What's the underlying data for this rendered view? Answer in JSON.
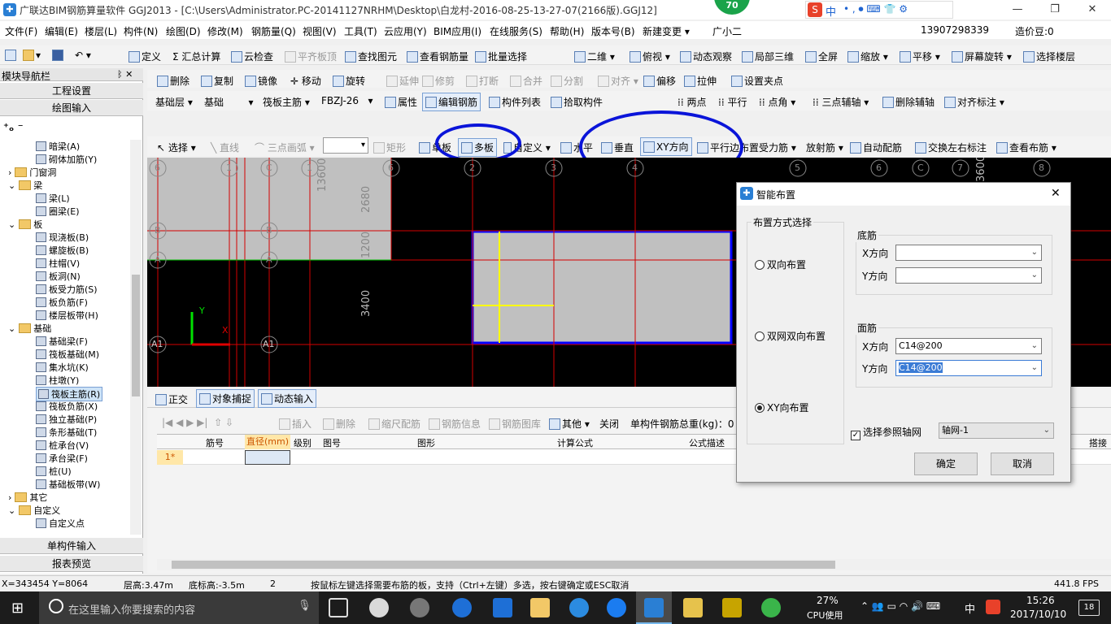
{
  "window": {
    "title": "广联达BIM钢筋算量软件 GGJ2013 - [C:\\Users\\Administrator.PC-20141127NRHM\\Desktop\\白龙村-2016-08-25-13-27-07(2166版).GGJ12]",
    "badge": "70",
    "ime": "中",
    "minimize": "—",
    "restore": "❐",
    "close": "✕"
  },
  "menubar": {
    "items": [
      "文件(F)",
      "编辑(E)",
      "楼层(L)",
      "构件(N)",
      "绘图(D)",
      "修改(M)",
      "钢筋量(Q)",
      "视图(V)",
      "工具(T)",
      "云应用(Y)",
      "BIM应用(I)",
      "在线服务(S)",
      "帮助(H)",
      "版本号(B)",
      "新建变更 ▾",
      "广小二"
    ],
    "phone": "13907298339",
    "price": "造价豆:0"
  },
  "toolbar1": {
    "items": [
      "定义",
      "汇总计算",
      "云检查",
      "平齐板顶",
      "查找图元",
      "查看钢筋量",
      "批量选择",
      "二维",
      "俯视",
      "动态观察",
      "局部三维",
      "全屏",
      "缩放",
      "平移",
      "屏幕旋转",
      "选择楼层"
    ]
  },
  "toolbar2": {
    "items": [
      "删除",
      "复制",
      "镜像",
      "移动",
      "旋转",
      "延伸",
      "修剪",
      "打断",
      "合并",
      "分割",
      "对齐",
      "偏移",
      "拉伸",
      "设置夹点"
    ]
  },
  "toolbar3": {
    "floor": "基础层",
    "category": "基础",
    "type": "筏板主筋",
    "name": "FBZJ-26",
    "items": [
      "属性",
      "编辑钢筋",
      "构件列表",
      "拾取构件",
      "两点",
      "平行",
      "点角",
      "三点辅轴",
      "删除辅轴",
      "对齐标注"
    ]
  },
  "toolbar4": {
    "items": [
      "选择",
      "直线",
      "三点画弧",
      "矩形",
      "单板",
      "多板",
      "自定义",
      "水平",
      "垂直",
      "XY方向",
      "平行边布置受力筋",
      "放射筋",
      "自动配筋",
      "交换左右标注",
      "查看布筋"
    ]
  },
  "leftnav": {
    "title": "模块导航栏",
    "pin": "ᛒ ✕",
    "tab1": "工程设置",
    "tab2": "绘图输入",
    "tree": [
      {
        "label": "暗梁(A)",
        "level": 2
      },
      {
        "label": "砌体加筋(Y)",
        "level": 2
      },
      {
        "label": "门窗洞",
        "level": 1,
        "folder": true,
        "exp": "›"
      },
      {
        "label": "梁",
        "level": 1,
        "folder": true,
        "exp": "⌄"
      },
      {
        "label": "梁(L)",
        "level": 2
      },
      {
        "label": "圈梁(E)",
        "level": 2
      },
      {
        "label": "板",
        "level": 1,
        "folder": true,
        "exp": "⌄"
      },
      {
        "label": "现浇板(B)",
        "level": 2
      },
      {
        "label": "螺旋板(B)",
        "level": 2
      },
      {
        "label": "柱帽(V)",
        "level": 2
      },
      {
        "label": "板洞(N)",
        "level": 2
      },
      {
        "label": "板受力筋(S)",
        "level": 2
      },
      {
        "label": "板负筋(F)",
        "level": 2
      },
      {
        "label": "楼层板带(H)",
        "level": 2
      },
      {
        "label": "基础",
        "level": 1,
        "folder": true,
        "exp": "⌄"
      },
      {
        "label": "基础梁(F)",
        "level": 2
      },
      {
        "label": "筏板基础(M)",
        "level": 2
      },
      {
        "label": "集水坑(K)",
        "level": 2
      },
      {
        "label": "柱墩(Y)",
        "level": 2
      },
      {
        "label": "筏板主筋(R)",
        "level": 2,
        "selected": true
      },
      {
        "label": "筏板负筋(X)",
        "level": 2
      },
      {
        "label": "独立基础(P)",
        "level": 2
      },
      {
        "label": "条形基础(T)",
        "level": 2
      },
      {
        "label": "桩承台(V)",
        "level": 2
      },
      {
        "label": "承台梁(F)",
        "level": 2
      },
      {
        "label": "桩(U)",
        "level": 2
      },
      {
        "label": "基础板带(W)",
        "level": 2
      },
      {
        "label": "其它",
        "level": 1,
        "folder": true,
        "exp": "›"
      },
      {
        "label": "自定义",
        "level": 1,
        "folder": true,
        "exp": "⌄"
      },
      {
        "label": "自定义点",
        "level": 2
      }
    ],
    "bottom1": "单构件输入",
    "bottom2": "报表预览"
  },
  "canvas": {
    "axis_top": [
      "6",
      "1",
      "C",
      "1",
      "6",
      "2",
      "3",
      "4",
      "5",
      "6",
      "C",
      "7",
      "8"
    ],
    "axis_left": [
      "B",
      "A",
      "A1"
    ],
    "axis_mid": [
      "B",
      "A",
      "A1"
    ],
    "dims": [
      "13600",
      "2680",
      "1200",
      "3400",
      "3600"
    ],
    "ucs_y": "Y",
    "ucs_x": "X"
  },
  "snapbar": {
    "items": [
      "正交",
      "对象捕捉",
      "动态输入"
    ]
  },
  "gridtoolbar": {
    "items": [
      "插入",
      "删除",
      "缩尺配筋",
      "钢筋信息",
      "钢筋图库",
      "其他",
      "关闭"
    ],
    "total": "单构件钢筋总重(kg)：0"
  },
  "grid": {
    "columns": [
      "筋号",
      "直径(mm)",
      "级别",
      "图号",
      "图形",
      "计算公式",
      "公式描述",
      "搭接"
    ],
    "rows": [
      {
        "num": "1*"
      }
    ]
  },
  "dialog": {
    "title": "智能布置",
    "close": "✕",
    "group_method": "布置方式选择",
    "radio1": "双向布置",
    "radio2": "双网双向布置",
    "radio3": "XY向布置",
    "group_bottom": "底筋",
    "bottom_x_label": "X方向",
    "bottom_y_label": "Y方向",
    "bottom_x": "",
    "bottom_y": "",
    "group_top": "面筋",
    "top_x_label": "X方向",
    "top_y_label": "Y方向",
    "top_x": "C14@200",
    "top_y": "C14@200",
    "checkbox_label": "选择参照轴网",
    "grid_select": "轴网-1",
    "ok": "确定",
    "cancel": "取消"
  },
  "statusbar": {
    "coords": "X=343454 Y=8064",
    "floor_height": "层高:3.47m",
    "base_height": "底标高:-3.5m",
    "num": "2",
    "hint": "按鼠标左键选择需要布筋的板，支持（Ctrl+左键）多选，按右键确定或ESC取消",
    "fps": "441.8 FPS"
  },
  "taskbar": {
    "search": "在这里输入你要搜索的内容",
    "cpu": "27%",
    "cpu_label": "CPU使用",
    "ime": "中",
    "time": "15:26",
    "date": "2017/10/10",
    "notif": "18"
  },
  "colors": {
    "annotation": "#0a14d9",
    "canvas_bg": "#000000",
    "slab": "#c0c0c0",
    "gridline": "#d40000",
    "selection": "#0000ff"
  }
}
